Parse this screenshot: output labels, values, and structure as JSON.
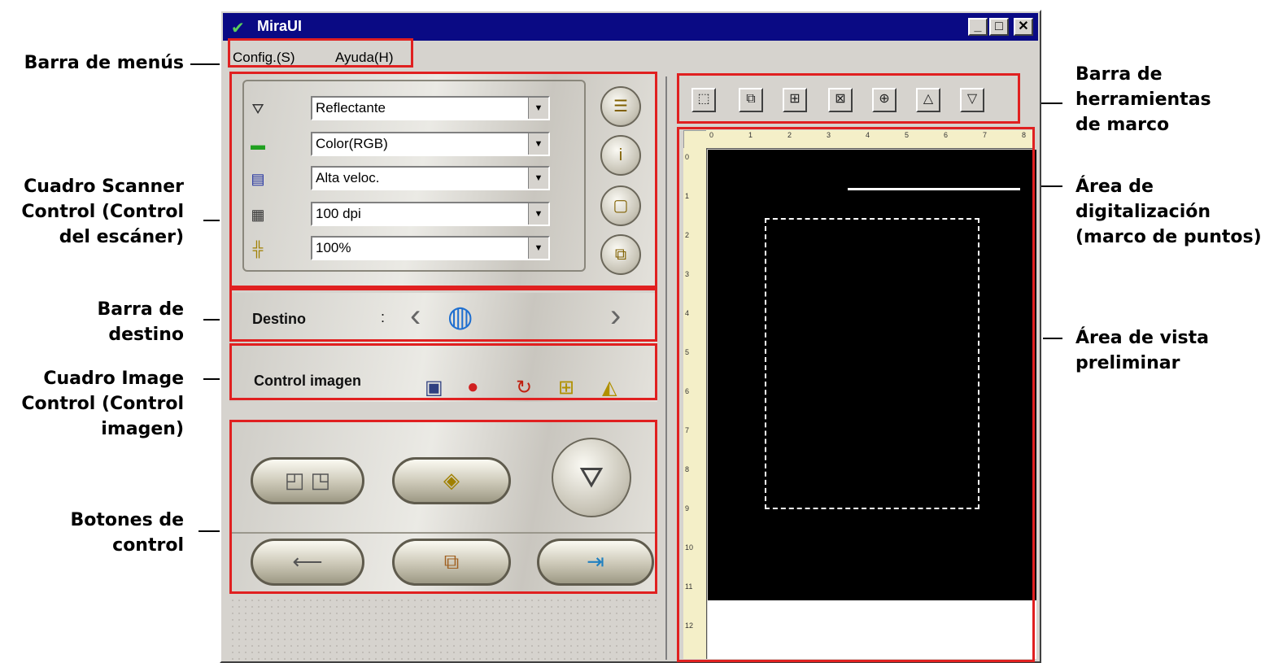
{
  "window": {
    "title": "MiraUI",
    "controls": {
      "minimize": "_",
      "maximize": "□",
      "close": "✕"
    }
  },
  "menubar": {
    "items": [
      "Config.(S)",
      "Ayuda(H)"
    ]
  },
  "scanner_control": {
    "rows": [
      {
        "icon": "scan-type-icon",
        "value": "Reflectante"
      },
      {
        "icon": "color-mode-icon",
        "value": "Color(RGB)"
      },
      {
        "icon": "scan-mode-icon",
        "value": "Alta veloc."
      },
      {
        "icon": "resolution-icon",
        "value": "100 dpi"
      },
      {
        "icon": "scale-icon",
        "value": "100%"
      }
    ],
    "side_buttons": [
      "settings-list-icon",
      "info-icon",
      "frame-icon",
      "copy-frame-icon"
    ]
  },
  "destination": {
    "label": "Destino",
    "separator": ":"
  },
  "image_control": {
    "label": "Control imagen",
    "tools": [
      "image-adjust-icon",
      "color-wheel-icon",
      "rotate-icon",
      "grid-icon",
      "mirror-icon"
    ]
  },
  "control_buttons": [
    "fit-frame-button",
    "preview-button",
    "scan-button",
    "back-button",
    "batch-button",
    "exit-button"
  ],
  "frame_toolbar": {
    "tools": [
      "select-frame-icon",
      "duplicate-frame-icon",
      "add-frame-icon",
      "delete-frame-icon",
      "zoom-icon",
      "up-arrow-icon",
      "down-arrow-icon"
    ]
  },
  "ruler": {
    "top_marks": [
      "0",
      "1",
      "2",
      "3",
      "4",
      "5",
      "6",
      "7",
      "8"
    ],
    "left_marks": [
      "0",
      "1",
      "2",
      "3",
      "4",
      "5",
      "6",
      "7",
      "8",
      "9",
      "10",
      "11",
      "12"
    ]
  },
  "callouts": {
    "menubar": "Barra de menús",
    "scanner_control": [
      "Cuadro Scanner",
      "Control (Control",
      "del escáner)"
    ],
    "destination": [
      "Barra de",
      "destino"
    ],
    "image_control": [
      "Cuadro Image",
      "Control (Control",
      "imagen)"
    ],
    "control_buttons": [
      "Botones de",
      "control"
    ],
    "frame_toolbar": [
      "Barra de",
      "herramientas",
      "de marco"
    ],
    "scan_area": [
      "Área de",
      "digitalización",
      "(marco de puntos)"
    ],
    "preview_area": [
      "Área de vista",
      "preliminar"
    ]
  }
}
